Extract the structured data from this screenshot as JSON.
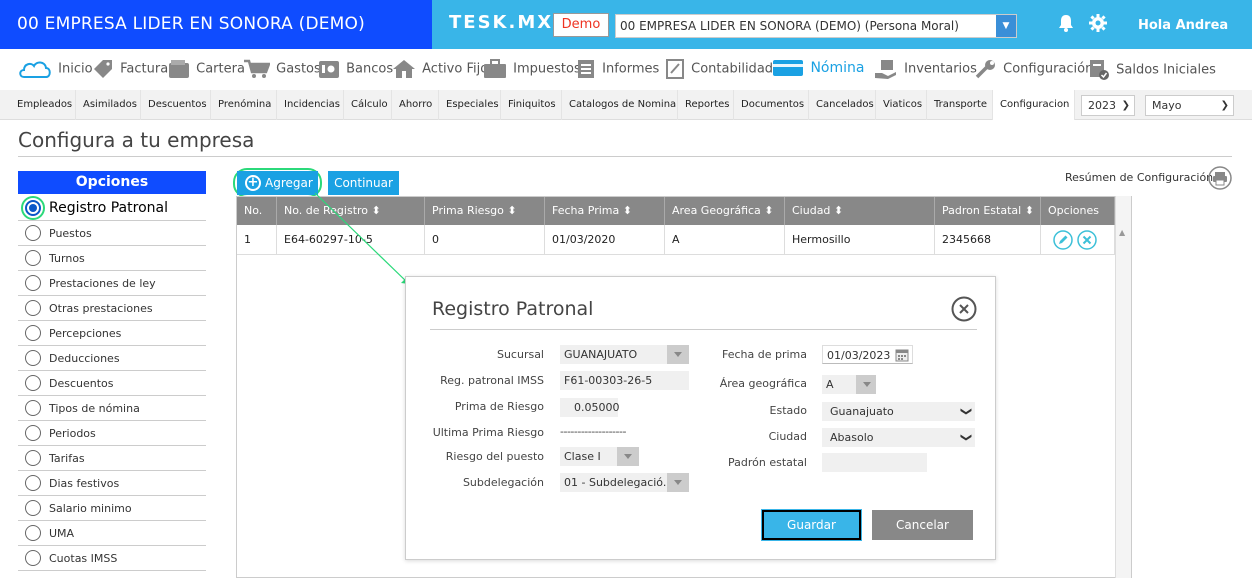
{
  "header": {
    "company_name": "00 EMPRESA LIDER EN SONORA (DEMO)",
    "brand": "TESK.MX",
    "demo_badge": "Demo",
    "company_select_value": "00 EMPRESA LIDER EN SONORA (DEMO) (Persona Moral)",
    "greeting": "Hola Andrea"
  },
  "main_nav": [
    {
      "label": "Inicio",
      "icon": "cloud-icon"
    },
    {
      "label": "Factura",
      "icon": "tag-icon"
    },
    {
      "label": "Cartera",
      "icon": "wallet-icon"
    },
    {
      "label": "Gastos",
      "icon": "cart-icon"
    },
    {
      "label": "Bancos",
      "icon": "safe-icon"
    },
    {
      "label": "Activo Fijo",
      "icon": "house-icon"
    },
    {
      "label": "Impuestos",
      "icon": "briefcase-icon"
    },
    {
      "label": "Informes",
      "icon": "document-icon"
    },
    {
      "label": "Contabilidad",
      "icon": "ledger-icon"
    },
    {
      "label": "Nómina",
      "icon": "card-icon",
      "active": true
    },
    {
      "label": "Inventarios",
      "icon": "hand-box-icon"
    },
    {
      "label": "Configuración",
      "icon": "wrench-icon"
    },
    {
      "label": "Saldos Iniciales",
      "icon": "doc-check-icon"
    }
  ],
  "sub_nav": {
    "tabs": [
      "Empleados",
      "Asimilados",
      "Descuentos",
      "Prenómina",
      "Incidencias",
      "Cálculo",
      "Ahorro",
      "Especiales",
      "Finiquitos",
      "Catalogos de Nomina",
      "Reportes",
      "Documentos",
      "Cancelados",
      "Viaticos",
      "Transporte",
      "Configuracion"
    ],
    "current": "Configuracion",
    "year": "2023",
    "month": "Mayo"
  },
  "page": {
    "title": "Configura a tu empresa"
  },
  "sidebar": {
    "heading": "Opciones",
    "items": [
      "Registro Patronal",
      "Puestos",
      "Turnos",
      "Prestaciones de ley",
      "Otras prestaciones",
      "Percepciones",
      "Deducciones",
      "Descuentos",
      "Tipos de nómina",
      "Periodos",
      "Tarifas",
      "Dias festivos",
      "Salario minimo",
      "UMA",
      "Cuotas IMSS"
    ],
    "selected": "Registro Patronal"
  },
  "toolbar": {
    "add_label": "Agregar",
    "continue_label": "Continuar",
    "summary_label": "Resúmen de Configuración"
  },
  "table": {
    "columns": [
      "No.",
      "No. de Registro",
      "Prima Riesgo",
      "Fecha Prima",
      "Area Geográfica",
      "Ciudad",
      "Padron Estatal",
      "Opciones"
    ],
    "rows": [
      [
        "1",
        "E64-60297-10-5",
        "0",
        "01/03/2020",
        "A",
        "Hermosillo",
        "2345668"
      ]
    ]
  },
  "modal": {
    "title": "Registro Patronal",
    "fields": {
      "sucursal_label": "Sucursal",
      "sucursal_value": "GUANAJUATO",
      "reg_imss_label": "Reg. patronal IMSS",
      "reg_imss_value": "F61-00303-26-5",
      "prima_riesgo_label": "Prima de Riesgo",
      "prima_riesgo_value": "0.05000",
      "ultima_prima_label": "Ultima Prima Riesgo",
      "ultima_prima_value": "-------------------",
      "riesgo_puesto_label": "Riesgo del puesto",
      "riesgo_puesto_value": "Clase I",
      "subdelegacion_label": "Subdelegación",
      "subdelegacion_value": "01 - Subdelegació...",
      "fecha_prima_label": "Fecha de prima",
      "fecha_prima_value": "01/03/2023",
      "area_geo_label": "Área geográfica",
      "area_geo_value": "A",
      "estado_label": "Estado",
      "estado_value": "Guanajuato",
      "ciudad_label": "Ciudad",
      "ciudad_value": "Abasolo",
      "padron_label": "Padrón estatal",
      "padron_value": ""
    },
    "save_label": "Guardar",
    "cancel_label": "Cancelar"
  },
  "colors": {
    "brand_blue": "#0f4cff",
    "accent_cyan": "#39b5e8",
    "button_blue": "#1aa1e3",
    "highlight_green": "#2bd97a",
    "demo_red": "#e32222"
  }
}
